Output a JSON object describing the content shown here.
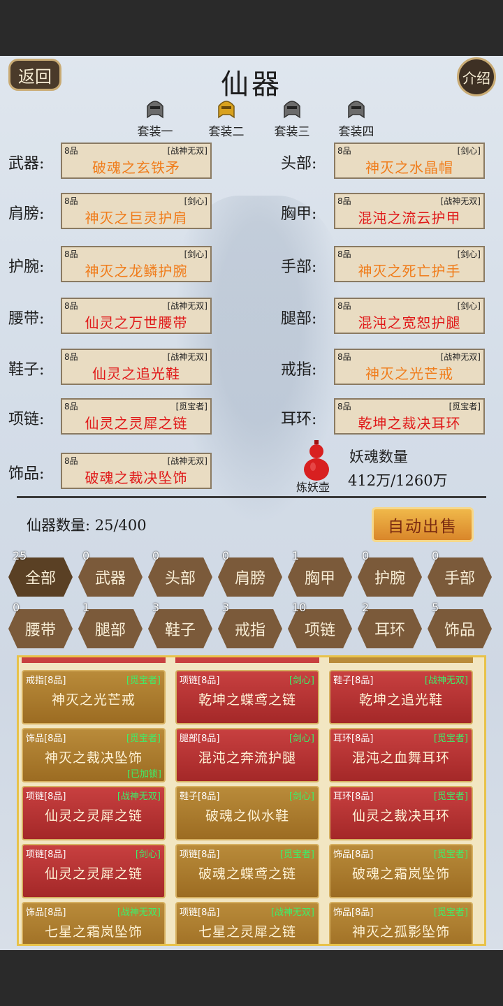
{
  "header": {
    "back": "返回",
    "title": "仙器",
    "intro": "介绍"
  },
  "sets": [
    {
      "label": "套装一",
      "color": "#6b6b6b"
    },
    {
      "label": "套装二",
      "color": "#d9a21e"
    },
    {
      "label": "套装三",
      "color": "#6b6b6b"
    },
    {
      "label": "套装四",
      "color": "#6b6b6b"
    }
  ],
  "slots": {
    "weapon": {
      "label": "武器:",
      "quality": "8品",
      "tag": "[战神无双]",
      "name": "破魂之玄铁矛",
      "color": "orange"
    },
    "head": {
      "label": "头部:",
      "quality": "8品",
      "tag": "[剑心]",
      "name": "神灭之水晶帽",
      "color": "orange"
    },
    "shoulder": {
      "label": "肩膀:",
      "quality": "8品",
      "tag": "[剑心]",
      "name": "神灭之巨灵护肩",
      "color": "orange"
    },
    "chest": {
      "label": "胸甲:",
      "quality": "8品",
      "tag": "[战神无双]",
      "name": "混沌之流云护甲",
      "color": "red"
    },
    "wrist": {
      "label": "护腕:",
      "quality": "8品",
      "tag": "[剑心]",
      "name": "神灭之龙鳞护腕",
      "color": "orange"
    },
    "hand": {
      "label": "手部:",
      "quality": "8品",
      "tag": "[剑心]",
      "name": "神灭之死亡护手",
      "color": "orange"
    },
    "belt": {
      "label": "腰带:",
      "quality": "8品",
      "tag": "[战神无双]",
      "name": "仙灵之万世腰带",
      "color": "red"
    },
    "leg": {
      "label": "腿部:",
      "quality": "8品",
      "tag": "[剑心]",
      "name": "混沌之宽恕护腿",
      "color": "red"
    },
    "shoe": {
      "label": "鞋子:",
      "quality": "8品",
      "tag": "[战神无双]",
      "name": "仙灵之追光鞋",
      "color": "red"
    },
    "ring": {
      "label": "戒指:",
      "quality": "8品",
      "tag": "[战神无双]",
      "name": "神灭之光芒戒",
      "color": "orange"
    },
    "necklace": {
      "label": "项链:",
      "quality": "8品",
      "tag": "[觅宝者]",
      "name": "仙灵之灵犀之链",
      "color": "red"
    },
    "earring": {
      "label": "耳环:",
      "quality": "8品",
      "tag": "[觅宝者]",
      "name": "乾坤之裁决耳环",
      "color": "red"
    },
    "ornament": {
      "label": "饰品:",
      "quality": "8品",
      "tag": "[战神无双]",
      "name": "破魂之裁决坠饰",
      "color": "red"
    }
  },
  "gourd": {
    "label": "炼妖壶",
    "soul_title": "妖魂数量",
    "soul_value": "412万/1260万"
  },
  "inventory_count": "仙器数量: 25/400",
  "auto_sell": "自动出售",
  "filters": [
    {
      "label": "全部",
      "count": "25",
      "active": true
    },
    {
      "label": "武器",
      "count": "0"
    },
    {
      "label": "头部",
      "count": "0"
    },
    {
      "label": "肩膀",
      "count": "0"
    },
    {
      "label": "胸甲",
      "count": "1"
    },
    {
      "label": "护腕",
      "count": "0"
    },
    {
      "label": "手部",
      "count": "0"
    },
    {
      "label": "腰带",
      "count": "0"
    },
    {
      "label": "腿部",
      "count": "1"
    },
    {
      "label": "鞋子",
      "count": "3"
    },
    {
      "label": "戒指",
      "count": "3"
    },
    {
      "label": "项链",
      "count": "10"
    },
    {
      "label": "耳环",
      "count": "2"
    },
    {
      "label": "饰品",
      "count": "5"
    }
  ],
  "items": [
    {
      "type": "戒指[8品]",
      "tag": "[觅宝者]",
      "name": "神灭之光芒戒",
      "style": "gold"
    },
    {
      "type": "项链[8品]",
      "tag": "[剑心]",
      "name": "乾坤之蝶鸢之链",
      "style": "crimson"
    },
    {
      "type": "鞋子[8品]",
      "tag": "[战神无双]",
      "name": "乾坤之追光鞋",
      "style": "crimson"
    },
    {
      "type": "饰品[8品]",
      "tag": "[觅宝者]",
      "name": "神灭之裁决坠饰",
      "style": "gold",
      "lock": "[已加锁]"
    },
    {
      "type": "腿部[8品]",
      "tag": "[剑心]",
      "name": "混沌之奔流护腿",
      "style": "crimson"
    },
    {
      "type": "耳环[8品]",
      "tag": "[觅宝者]",
      "name": "混沌之血舞耳环",
      "style": "crimson"
    },
    {
      "type": "项链[8品]",
      "tag": "[战神无双]",
      "name": "仙灵之灵犀之链",
      "style": "crimson"
    },
    {
      "type": "鞋子[8品]",
      "tag": "[剑心]",
      "name": "破魂之似水鞋",
      "style": "gold"
    },
    {
      "type": "耳环[8品]",
      "tag": "[觅宝者]",
      "name": "仙灵之裁决耳环",
      "style": "crimson"
    },
    {
      "type": "项链[8品]",
      "tag": "[剑心]",
      "name": "仙灵之灵犀之链",
      "style": "crimson"
    },
    {
      "type": "项链[8品]",
      "tag": "[觅宝者]",
      "name": "破魂之蝶鸢之链",
      "style": "gold"
    },
    {
      "type": "饰品[8品]",
      "tag": "[觅宝者]",
      "name": "破魂之霜岚坠饰",
      "style": "gold"
    },
    {
      "type": "饰品[8品]",
      "tag": "[战神无双]",
      "name": "七星之霜岚坠饰",
      "style": "gold"
    },
    {
      "type": "项链[8品]",
      "tag": "[战神无双]",
      "name": "七星之灵犀之链",
      "style": "gold"
    },
    {
      "type": "饰品[8品]",
      "tag": "[觅宝者]",
      "name": "神灭之孤影坠饰",
      "style": "gold"
    }
  ]
}
